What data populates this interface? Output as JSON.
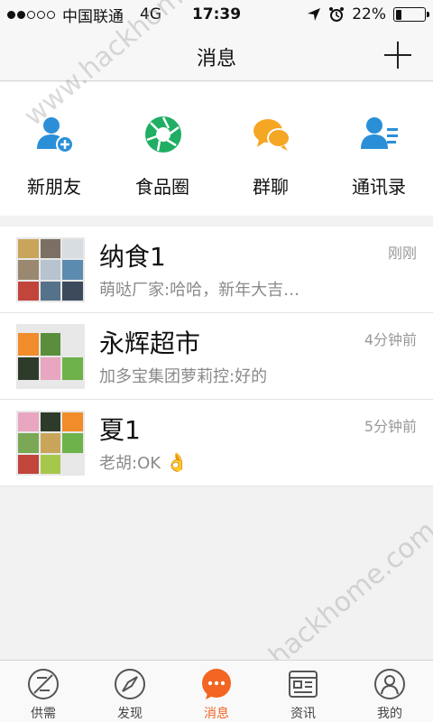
{
  "status_bar": {
    "carrier": "中国联通",
    "network": "4G",
    "time": "17:39",
    "battery": "22%",
    "battery_level": 0.22
  },
  "header": {
    "title": "消息",
    "add_icon": "plus-icon"
  },
  "quick_actions": [
    {
      "label": "新朋友",
      "icon": "add-friend-icon",
      "color": "#2b8fd8"
    },
    {
      "label": "食品圈",
      "icon": "aperture-icon",
      "color": "#1fae63"
    },
    {
      "label": "群聊",
      "icon": "chat-bubbles-icon",
      "color": "#f5a623"
    },
    {
      "label": "通讯录",
      "icon": "contacts-icon",
      "color": "#2b8fd8"
    }
  ],
  "chats": [
    {
      "name": "纳食1",
      "time": "刚刚",
      "preview": "萌哒厂家:哈哈，新年大吉…"
    },
    {
      "name": "永辉超市",
      "time": "4分钟前",
      "preview": "加多宝集团萝莉控:好的"
    },
    {
      "name": "夏1",
      "time": "5分钟前",
      "preview": "老胡:OK"
    }
  ],
  "tabs": [
    {
      "label": "供需",
      "icon": "supply-demand-icon",
      "active": false
    },
    {
      "label": "发现",
      "icon": "compass-icon",
      "active": false
    },
    {
      "label": "消息",
      "icon": "message-icon",
      "active": true
    },
    {
      "label": "资讯",
      "icon": "news-icon",
      "active": false
    },
    {
      "label": "我的",
      "icon": "profile-icon",
      "active": false
    }
  ],
  "watermark": "www.hackhome.com",
  "colors": {
    "accent": "#f26522",
    "blue": "#2b8fd8",
    "green": "#1fae63",
    "orange": "#f5a623"
  }
}
